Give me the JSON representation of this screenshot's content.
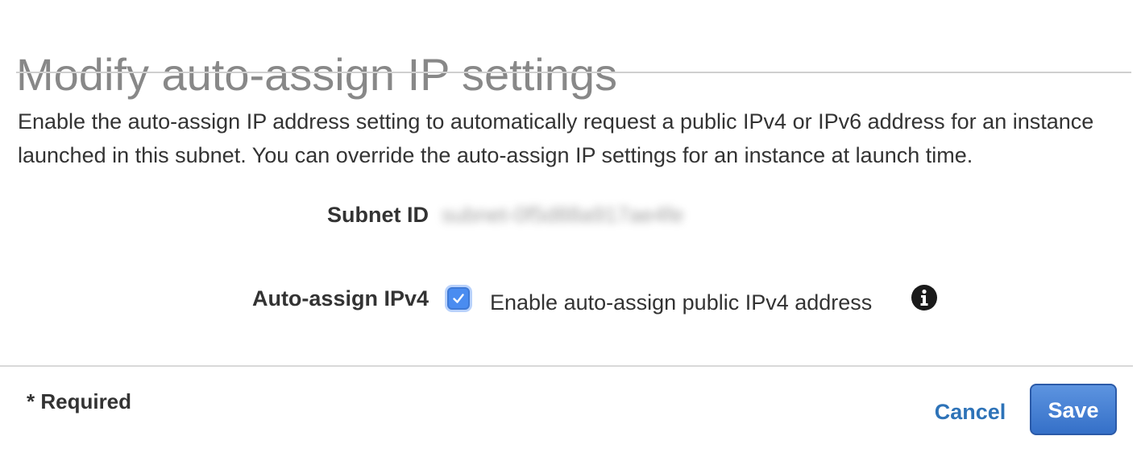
{
  "dialog": {
    "title": "Modify auto-assign IP settings",
    "description": "Enable the auto-assign IP address setting to automatically request a public IPv4 or IPv6 address for an instance launched in this subnet. You can override the auto-assign IP settings for an instance at launch time."
  },
  "form": {
    "subnet_id": {
      "label": "Subnet ID",
      "value": "subnet-0f5d88a917ae4fe"
    },
    "auto_assign_ipv4": {
      "label": "Auto-assign IPv4",
      "checked": true,
      "checkbox_label": "Enable auto-assign public IPv4 address",
      "info_icon": "info-icon"
    }
  },
  "footer": {
    "required_note": "* Required",
    "cancel_label": "Cancel",
    "save_label": "Save"
  },
  "colors": {
    "title": "#888888",
    "link": "#2e73b8",
    "primary_button": "#3570c8",
    "checkbox": "#4a8cf0"
  }
}
